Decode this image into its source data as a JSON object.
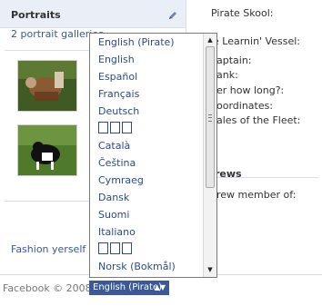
{
  "portraits": {
    "title": "Portraits",
    "galleries_link": "2 portrait galleries",
    "fashion_link": "Fashion yerself a"
  },
  "info": {
    "pirate_skool": "Pirate Skool:",
    "vessel": "e Learnin' Vessel:",
    "captain": "aptain:",
    "rank": "ank:",
    "how_long": "er how long?:",
    "coordinates": "oordinates:",
    "tales": "ales of the Fleet:"
  },
  "crews": {
    "title": "rews",
    "member_of": "rew member of:"
  },
  "footer": {
    "copyright": "Facebook © 2008",
    "language": "English (Pirate)",
    "select_arrows": "▲▼"
  },
  "dropdown": {
    "items": [
      "English (Pirate)",
      "English",
      "Español",
      "Français",
      "Deutsch",
      "\u0000",
      "Català",
      "Čeština",
      "Cymraeg",
      "Dansk",
      "Suomi",
      "Italiano",
      "\u0000",
      "Norsk (Bokmål)"
    ],
    "cjk_1": " ",
    "cjk_2": " "
  },
  "colors": {
    "link": "#3b5998",
    "header_bg": "#e9eef7",
    "select_bg": "#3b5998"
  }
}
